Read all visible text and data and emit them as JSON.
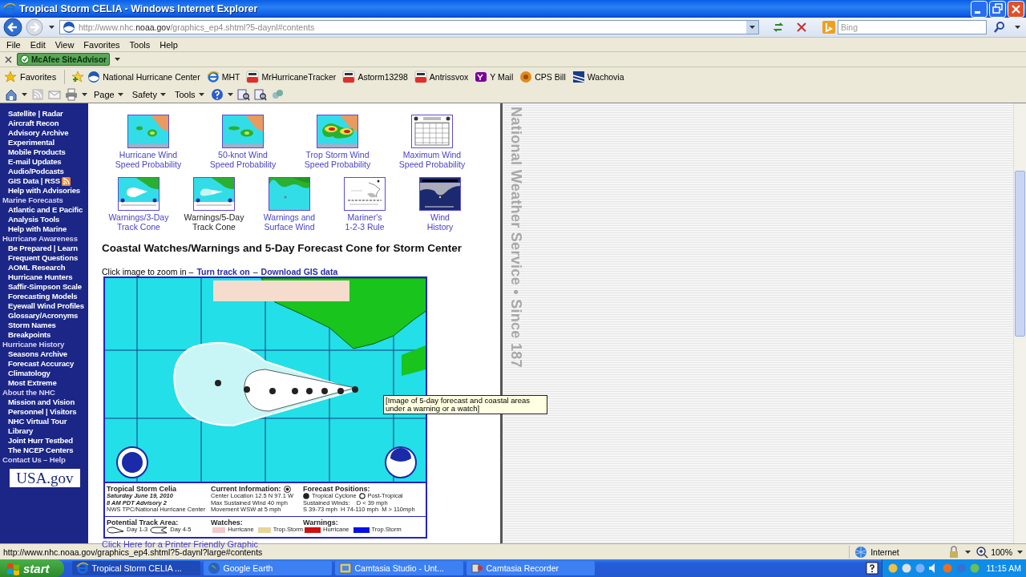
{
  "window": {
    "title": "Tropical Storm CELIA - Windows Internet Explorer"
  },
  "address_bar": {
    "url": "http://www.nhc.**noaa.gov**/graphics_ep4.shtml?5-daynl#contents"
  },
  "search": {
    "placeholder": "Bing"
  },
  "menu": [
    "File",
    "Edit",
    "View",
    "Favorites",
    "Tools",
    "Help"
  ],
  "addon_bar": {
    "label": "McAfee SiteAdvisor"
  },
  "favorites_bar": {
    "label": "Favorites",
    "items": [
      {
        "label": "National Hurricane Center",
        "kind": "noaa"
      },
      {
        "label": "MHT",
        "kind": "ie"
      },
      {
        "label": "MrHurricaneTracker",
        "kind": "video"
      },
      {
        "label": "Astorm13298",
        "kind": "video"
      },
      {
        "label": "Antrissvox",
        "kind": "video"
      },
      {
        "label": "Y Mail",
        "kind": "mail"
      },
      {
        "label": "CPS Bill",
        "kind": "flower"
      },
      {
        "label": "Wachovia",
        "kind": "bank"
      }
    ]
  },
  "command_bar": [
    "Page",
    "Safety",
    "Tools"
  ],
  "sidebar": {
    "sections": [
      {
        "items": [
          {
            "label": "Satellite | Radar"
          },
          {
            "label": "Aircraft Recon"
          },
          {
            "label": "Advisory Archive"
          },
          {
            "label": "Experimental"
          },
          {
            "label": "Mobile Products"
          },
          {
            "label": "E-mail Updates"
          },
          {
            "label": "Audio/Podcasts"
          },
          {
            "label": "GIS Data | RSS",
            "feed_icon": true
          },
          {
            "label": "Help with Advisories"
          }
        ]
      },
      {
        "heading": "Marine Forecasts",
        "items": [
          {
            "label": "Atlantic and E Pacific"
          },
          {
            "label": "Analysis Tools"
          },
          {
            "label": "Help with Marine"
          }
        ]
      },
      {
        "heading": "Hurricane Awareness",
        "items": [
          {
            "label": "Be Prepared | Learn"
          },
          {
            "label": "Frequent Questions"
          },
          {
            "label": "AOML Research"
          },
          {
            "label": "Hurricane Hunters"
          },
          {
            "label": "Saffir-Simpson Scale"
          },
          {
            "label": "Forecasting Models"
          },
          {
            "label": "Eyewall Wind Profiles"
          },
          {
            "label": "Glossary/Acronyms"
          },
          {
            "label": "Storm Names"
          },
          {
            "label": "Breakpoints"
          }
        ]
      },
      {
        "heading": "Hurricane History",
        "items": [
          {
            "label": "Seasons Archive"
          },
          {
            "label": "Forecast Accuracy"
          },
          {
            "label": "Climatology"
          },
          {
            "label": "Most Extreme"
          }
        ]
      },
      {
        "heading": "About the NHC",
        "items": [
          {
            "label": "Mission and Vision"
          },
          {
            "label": "Personnel | Visitors"
          },
          {
            "label": "NHC Virtual Tour"
          },
          {
            "label": "Library"
          },
          {
            "label": "Joint Hurr Testbed"
          },
          {
            "label": "The NCEP Centers"
          }
        ]
      },
      {
        "heading": "Contact Us – Help"
      }
    ],
    "logo": "USA.gov"
  },
  "products": [
    [
      {
        "label": [
          "Hurricane Wind",
          "Speed Probability"
        ],
        "selected": false
      },
      {
        "label": [
          "50-knot Wind",
          "Speed Probability"
        ],
        "selected": false
      },
      {
        "label": [
          "Trop Storm Wind",
          "Speed Probability"
        ],
        "selected": false
      },
      {
        "label": [
          "Maximum Wind",
          "Speed Probability"
        ],
        "selected": false
      }
    ],
    [
      {
        "label": [
          "Warnings/3-Day",
          "Track Cone"
        ],
        "selected": false
      },
      {
        "label": [
          "Warnings/5-Day",
          "Track Cone"
        ],
        "selected": true
      },
      {
        "label": [
          "Warnings and",
          "Surface Wind"
        ],
        "selected": false
      },
      {
        "label": [
          "Mariner's",
          "1-2-3 Rule"
        ],
        "selected": false
      },
      {
        "label": [
          "Wind",
          "History"
        ],
        "selected": false
      }
    ]
  ],
  "heading": "Coastal Watches/Warnings and 5-Day Forecast Cone for Storm Center",
  "intro": {
    "text": "Click image to zoom in –",
    "links": [
      "Turn track on",
      "Download GIS data"
    ],
    "separator": "–"
  },
  "forecast_map": {
    "kind": "picture",
    "legend": {
      "storm": "Tropical Storm Celia",
      "date": "Saturday June 19, 2010",
      "advisory": "8 AM PDT Advisory 2",
      "source": "NWS TPC/National Hurricane Center",
      "current_title": "Current Information:",
      "current_lines": [
        "Center Location 12.5 N 97.1 W",
        "Max Sustained Wind 40 mph",
        "Movement WSW at 5 mph"
      ],
      "forecast_title": "Forecast Positions:",
      "forecast_symbols": [
        "Tropical Cyclone",
        "Post-Tropical"
      ],
      "forecast_lines": [
        "Sustained Winds:    D < 39 mph",
        "S 39-73 mph  H 74-110 mph  M > 110mph"
      ],
      "track_title": "Potential Track Area:",
      "track_items": [
        "Day 1-3",
        "Day 4-5"
      ],
      "watches_title": "Watches:",
      "watches": [
        {
          "label": "Hurricane",
          "color": "#f2c8c8"
        },
        {
          "label": "Trop.Storm",
          "color": "#e6d49a"
        }
      ],
      "warnings_title": "Warnings:",
      "warnings": [
        {
          "label": "Hurricane",
          "color": "#d01010"
        },
        {
          "label": "Trop.Storm",
          "color": "#0010e8"
        }
      ]
    }
  },
  "tooltip": "[Image of 5-day forecast and coastal areas under a warning or a watch]",
  "printer_link": "Click Here for a Printer Friendly Graphic",
  "side_banner": "National Weather Service • Since 187",
  "status_bar": {
    "url": "http://www.nhc.noaa.gov/graphics_ep4.shtml?5-daynl?large#contents",
    "zone": "Internet",
    "zoom": "100%"
  },
  "taskbar": {
    "start": "start",
    "tasks": [
      {
        "label": "Tropical Storm CELIA ...",
        "selected": true
      },
      {
        "label": "Google Earth",
        "selected": false
      },
      {
        "label": "Camtasia Studio - Unt...",
        "selected": false
      },
      {
        "label": "Camtasia Recorder",
        "selected": false
      }
    ],
    "clock": "11:15 AM"
  }
}
